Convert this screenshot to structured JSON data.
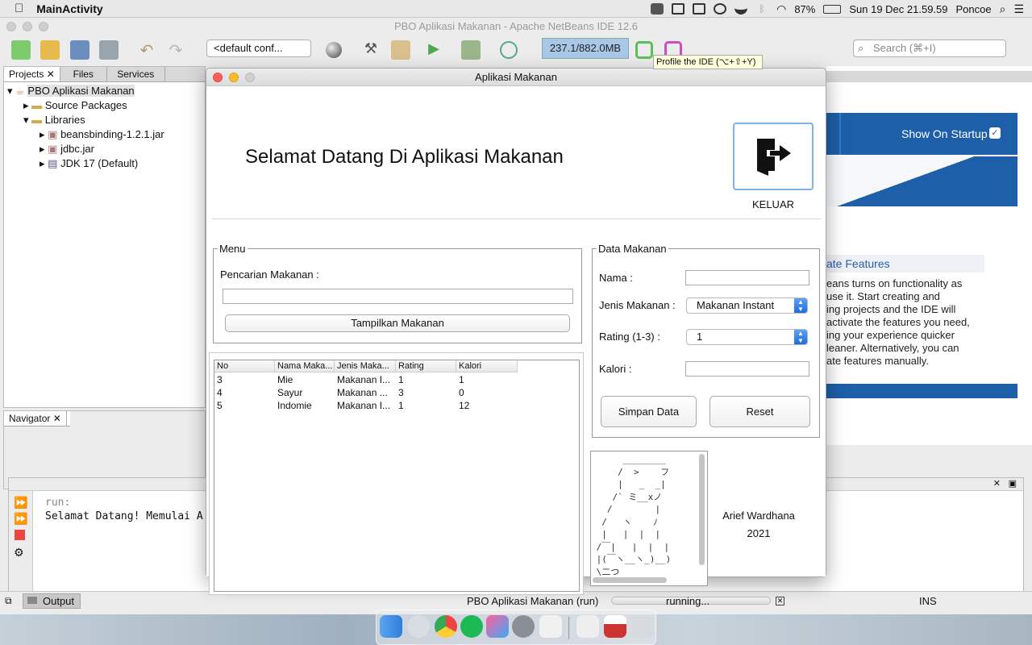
{
  "menubar": {
    "app_name": "MainActivity",
    "battery": "87%",
    "clock": "Sun 19 Dec  21.59.59",
    "user": "Poncoe"
  },
  "ide": {
    "window_title": "PBO Aplikasi Makanan - Apache NetBeans IDE 12.6",
    "config_dropdown": "<default conf...",
    "memory": "237.1/882.0MB",
    "tooltip": "Profile the IDE (⌥+⇧+Y)",
    "search_placeholder": "Search (⌘+I)",
    "tabs": [
      "Projects",
      "Files",
      "Services"
    ],
    "tree": {
      "project": "PBO Aplikasi Makanan",
      "source_packages": "Source Packages",
      "libraries": "Libraries",
      "lib_items": [
        "beansbinding-1.2.1.jar",
        "jdbc.jar",
        "JDK 17 (Default)"
      ]
    },
    "navigator_tab": "Navigator",
    "output_tab": "Output",
    "output_lines": [
      "run:",
      "Selamat Datang! Memulai A"
    ],
    "status_task": "PBO Aplikasi Makanan (run)",
    "status_running": "running...",
    "status_ins": "INS",
    "welcome": {
      "show_on_startup": "Show On Startup",
      "features_link": "ate Features",
      "text_lines": [
        "eans turns on functionality as",
        "use it. Start creating and",
        "ing projects and the IDE will",
        "activate the features you need,",
        "ing your experience quicker",
        "leaner. Alternatively, you can",
        "ate features manually."
      ]
    }
  },
  "app": {
    "title": "Aplikasi Makanan",
    "heading": "Selamat Datang Di Aplikasi Makanan",
    "exit_label": "KELUAR",
    "menu": {
      "legend": "Menu",
      "search_label": "Pencarian Makanan :",
      "search_value": "",
      "show_button": "Tampilkan Makanan"
    },
    "table": {
      "headers": [
        "No",
        "Nama Maka...",
        "Jenis Maka...",
        "Rating",
        "Kalori"
      ],
      "rows": [
        [
          "3",
          "Mie",
          "Makanan I...",
          "1",
          "1"
        ],
        [
          "4",
          "Sayur",
          "Makanan ...",
          "3",
          "0"
        ],
        [
          "5",
          "Indomie",
          "Makanan I...",
          "1",
          "12"
        ]
      ]
    },
    "form": {
      "legend": "Data Makanan",
      "name_label": "Nama :",
      "name_value": "",
      "type_label": "Jenis Makanan :",
      "type_value": "Makanan Instant",
      "rating_label": "Rating (1-3) :",
      "rating_value": "1",
      "calorie_label": "Kalori :",
      "calorie_value": "",
      "save_button": "Simpan Data",
      "reset_button": "Reset"
    },
    "ascii_art": "      ________\n     /  >    フ\n     |   _  _|\n    /` ミ__xノ\n   /        |\n  /   ヽ    ﾉ\n  |   |  |  |\n /￣|   |  |  |\n |(￣ヽ__ヽ_)__)\n \\二つ",
    "author_name": "Arief Wardhana",
    "author_year": "2021"
  },
  "colors": {
    "accent_blue": "#1a6ee0",
    "welcome_blue": "#1d5fa8",
    "close_red": "#fc5f57",
    "minimize_yellow": "#fdbc2e"
  }
}
